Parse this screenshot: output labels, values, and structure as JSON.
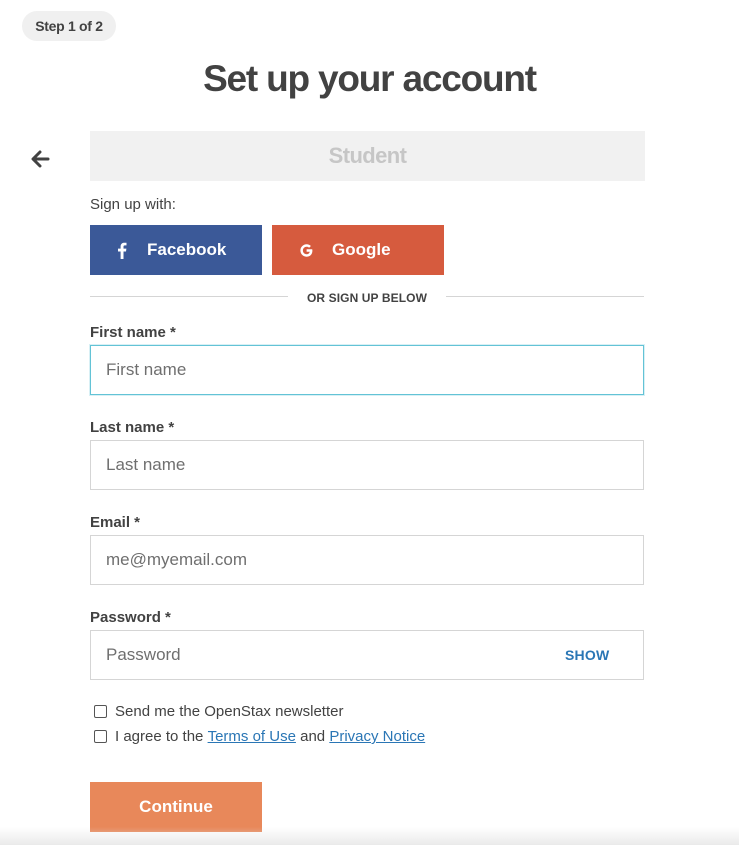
{
  "step": {
    "label": "Step 1 of 2"
  },
  "title": "Set up your account",
  "back": {
    "icon": "arrow-left-icon"
  },
  "role": {
    "label": "Student"
  },
  "social": {
    "prompt": "Sign up with:",
    "facebook": {
      "label": "Facebook",
      "icon": "facebook-icon",
      "color": "#3b5998"
    },
    "google": {
      "label": "Google",
      "icon": "google-icon",
      "color": "#d65b3e"
    }
  },
  "divider": {
    "text": "OR SIGN UP BELOW"
  },
  "form": {
    "first_name": {
      "label": "First name *",
      "placeholder": "First name",
      "value": ""
    },
    "last_name": {
      "label": "Last name *",
      "placeholder": "Last name",
      "value": ""
    },
    "email": {
      "label": "Email *",
      "placeholder": "me@myemail.com",
      "value": ""
    },
    "password": {
      "label": "Password *",
      "placeholder": "Password",
      "value": "",
      "toggle_label": "SHOW"
    }
  },
  "checkboxes": {
    "newsletter": {
      "label": "Send me the OpenStax newsletter",
      "checked": false
    },
    "terms": {
      "prefix": "I agree to the",
      "terms_link": "Terms of Use",
      "conjunction": "and",
      "privacy_link": "Privacy Notice",
      "checked": false
    }
  },
  "submit": {
    "label": "Continue",
    "color": "#e8885a"
  },
  "colors": {
    "accent_link": "#2a76b5",
    "focus_border": "#63c3d6",
    "text": "#424242"
  }
}
